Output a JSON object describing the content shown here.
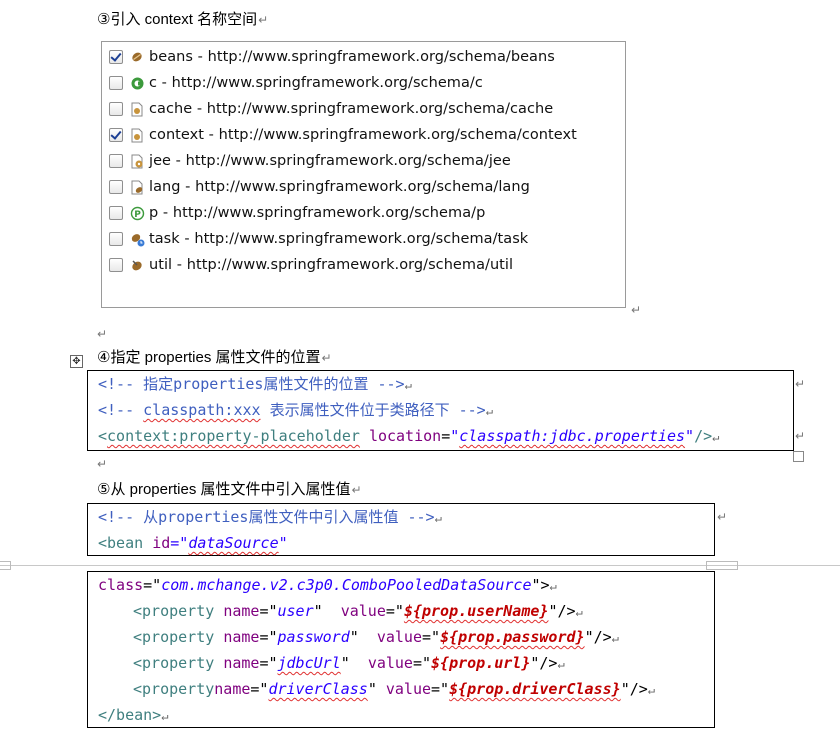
{
  "headings": {
    "h3": "③引入 context 名称空间",
    "h4": "④指定 properties 属性文件的位置",
    "h5": "⑤从 properties 属性文件中引入属性值"
  },
  "namespaces": [
    {
      "label": "beans - http://www.springframework.org/schema/beans",
      "checked": true,
      "icon": "bean-icon"
    },
    {
      "label": "c - http://www.springframework.org/schema/c",
      "checked": false,
      "icon": "c-namespace-icon"
    },
    {
      "label": "cache - http://www.springframework.org/schema/cache",
      "checked": false,
      "icon": "cache-icon"
    },
    {
      "label": "context - http://www.springframework.org/schema/context",
      "checked": true,
      "icon": "context-icon"
    },
    {
      "label": "jee - http://www.springframework.org/schema/jee",
      "checked": false,
      "icon": "jee-icon"
    },
    {
      "label": "lang - http://www.springframework.org/schema/lang",
      "checked": false,
      "icon": "lang-icon"
    },
    {
      "label": "p - http://www.springframework.org/schema/p",
      "checked": false,
      "icon": "p-namespace-icon"
    },
    {
      "label": "task - http://www.springframework.org/schema/task",
      "checked": false,
      "icon": "task-icon"
    },
    {
      "label": "util - http://www.springframework.org/schema/util",
      "checked": false,
      "icon": "util-icon"
    }
  ],
  "code1": {
    "comment1": "<!-- 指定properties属性文件的位置 -->",
    "comment2_a": "<!-- ",
    "comment2_b": "classpath:xxx",
    "comment2_c": " 表示属性文件位于类路径下 -->",
    "tag_open": "<",
    "tag_name": "context:property-placeholder",
    "attr": "location",
    "eq": "=",
    "q": "\"",
    "val": "classpath:jdbc.properties",
    "close": "/>"
  },
  "code2": {
    "comment": "<!-- 从properties属性文件中引入属性值 -->",
    "tag": "<bean",
    "attr": "id",
    "eq": "=\"",
    "val": "dataSource",
    "q": "\""
  },
  "code3": {
    "class_attr": "class",
    "class_eq": "=\"",
    "class_val": "com.mchange.v2.c3p0.ComboPooledDataSource",
    "class_close": "\">",
    "props": [
      {
        "tag": "<property",
        "name_attr": "name",
        "name_val": "user",
        "value_attr": "value",
        "value_val": "${prop.userName}"
      },
      {
        "tag": "<property",
        "name_attr": "name",
        "name_val": "password",
        "value_attr": "value",
        "value_val": "${prop.password}"
      },
      {
        "tag": "<property",
        "name_attr": "name",
        "name_val": "jdbcUrl",
        "value_attr": "value",
        "value_val": "${prop.url}"
      },
      {
        "tag": "<property",
        "name_attr": "name",
        "name_val": "driverClass",
        "value_attr": "value",
        "value_val": "${prop.driverClass}"
      }
    ],
    "end_tag": "</bean>"
  },
  "marks": {
    "paragraph": "↵"
  }
}
